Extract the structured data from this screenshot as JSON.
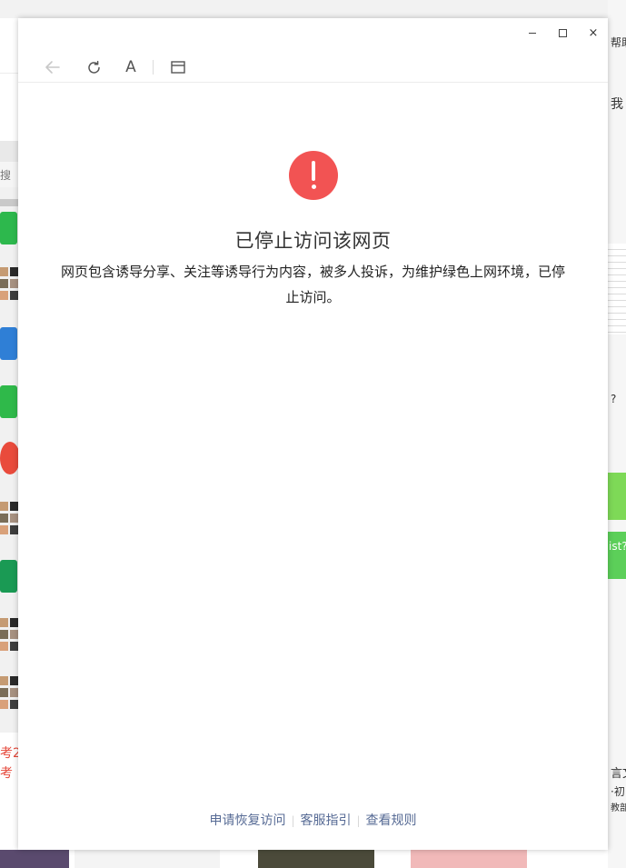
{
  "background": {
    "left_search_text": "搜",
    "left_red_text_1": "考2",
    "left_red_text_2": "考",
    "right_texts": {
      "help": "帮助",
      "me": "我",
      "q": "?",
      "blue": "ist?",
      "lang_1": "言文",
      "lang_2": "·初",
      "lang_3": "教部"
    }
  },
  "window_controls": {
    "minimize": "minimize",
    "maximize": "maximize",
    "close": "×"
  },
  "toolbar": {
    "font_label": "A",
    "icons": {
      "back": "back-arrow-icon",
      "refresh": "refresh-icon",
      "window": "window-icon"
    }
  },
  "message": {
    "title": "已停止访问该网页",
    "description": "网页包含诱导分享、关注等诱导行为内容，被多人投诉，为维护绿色上网环境，已停止访问。",
    "icon_color": "#f25353"
  },
  "footer": {
    "links": [
      "申请恢复访问",
      "客服指引",
      "查看规则"
    ],
    "link_color": "#576b95"
  }
}
